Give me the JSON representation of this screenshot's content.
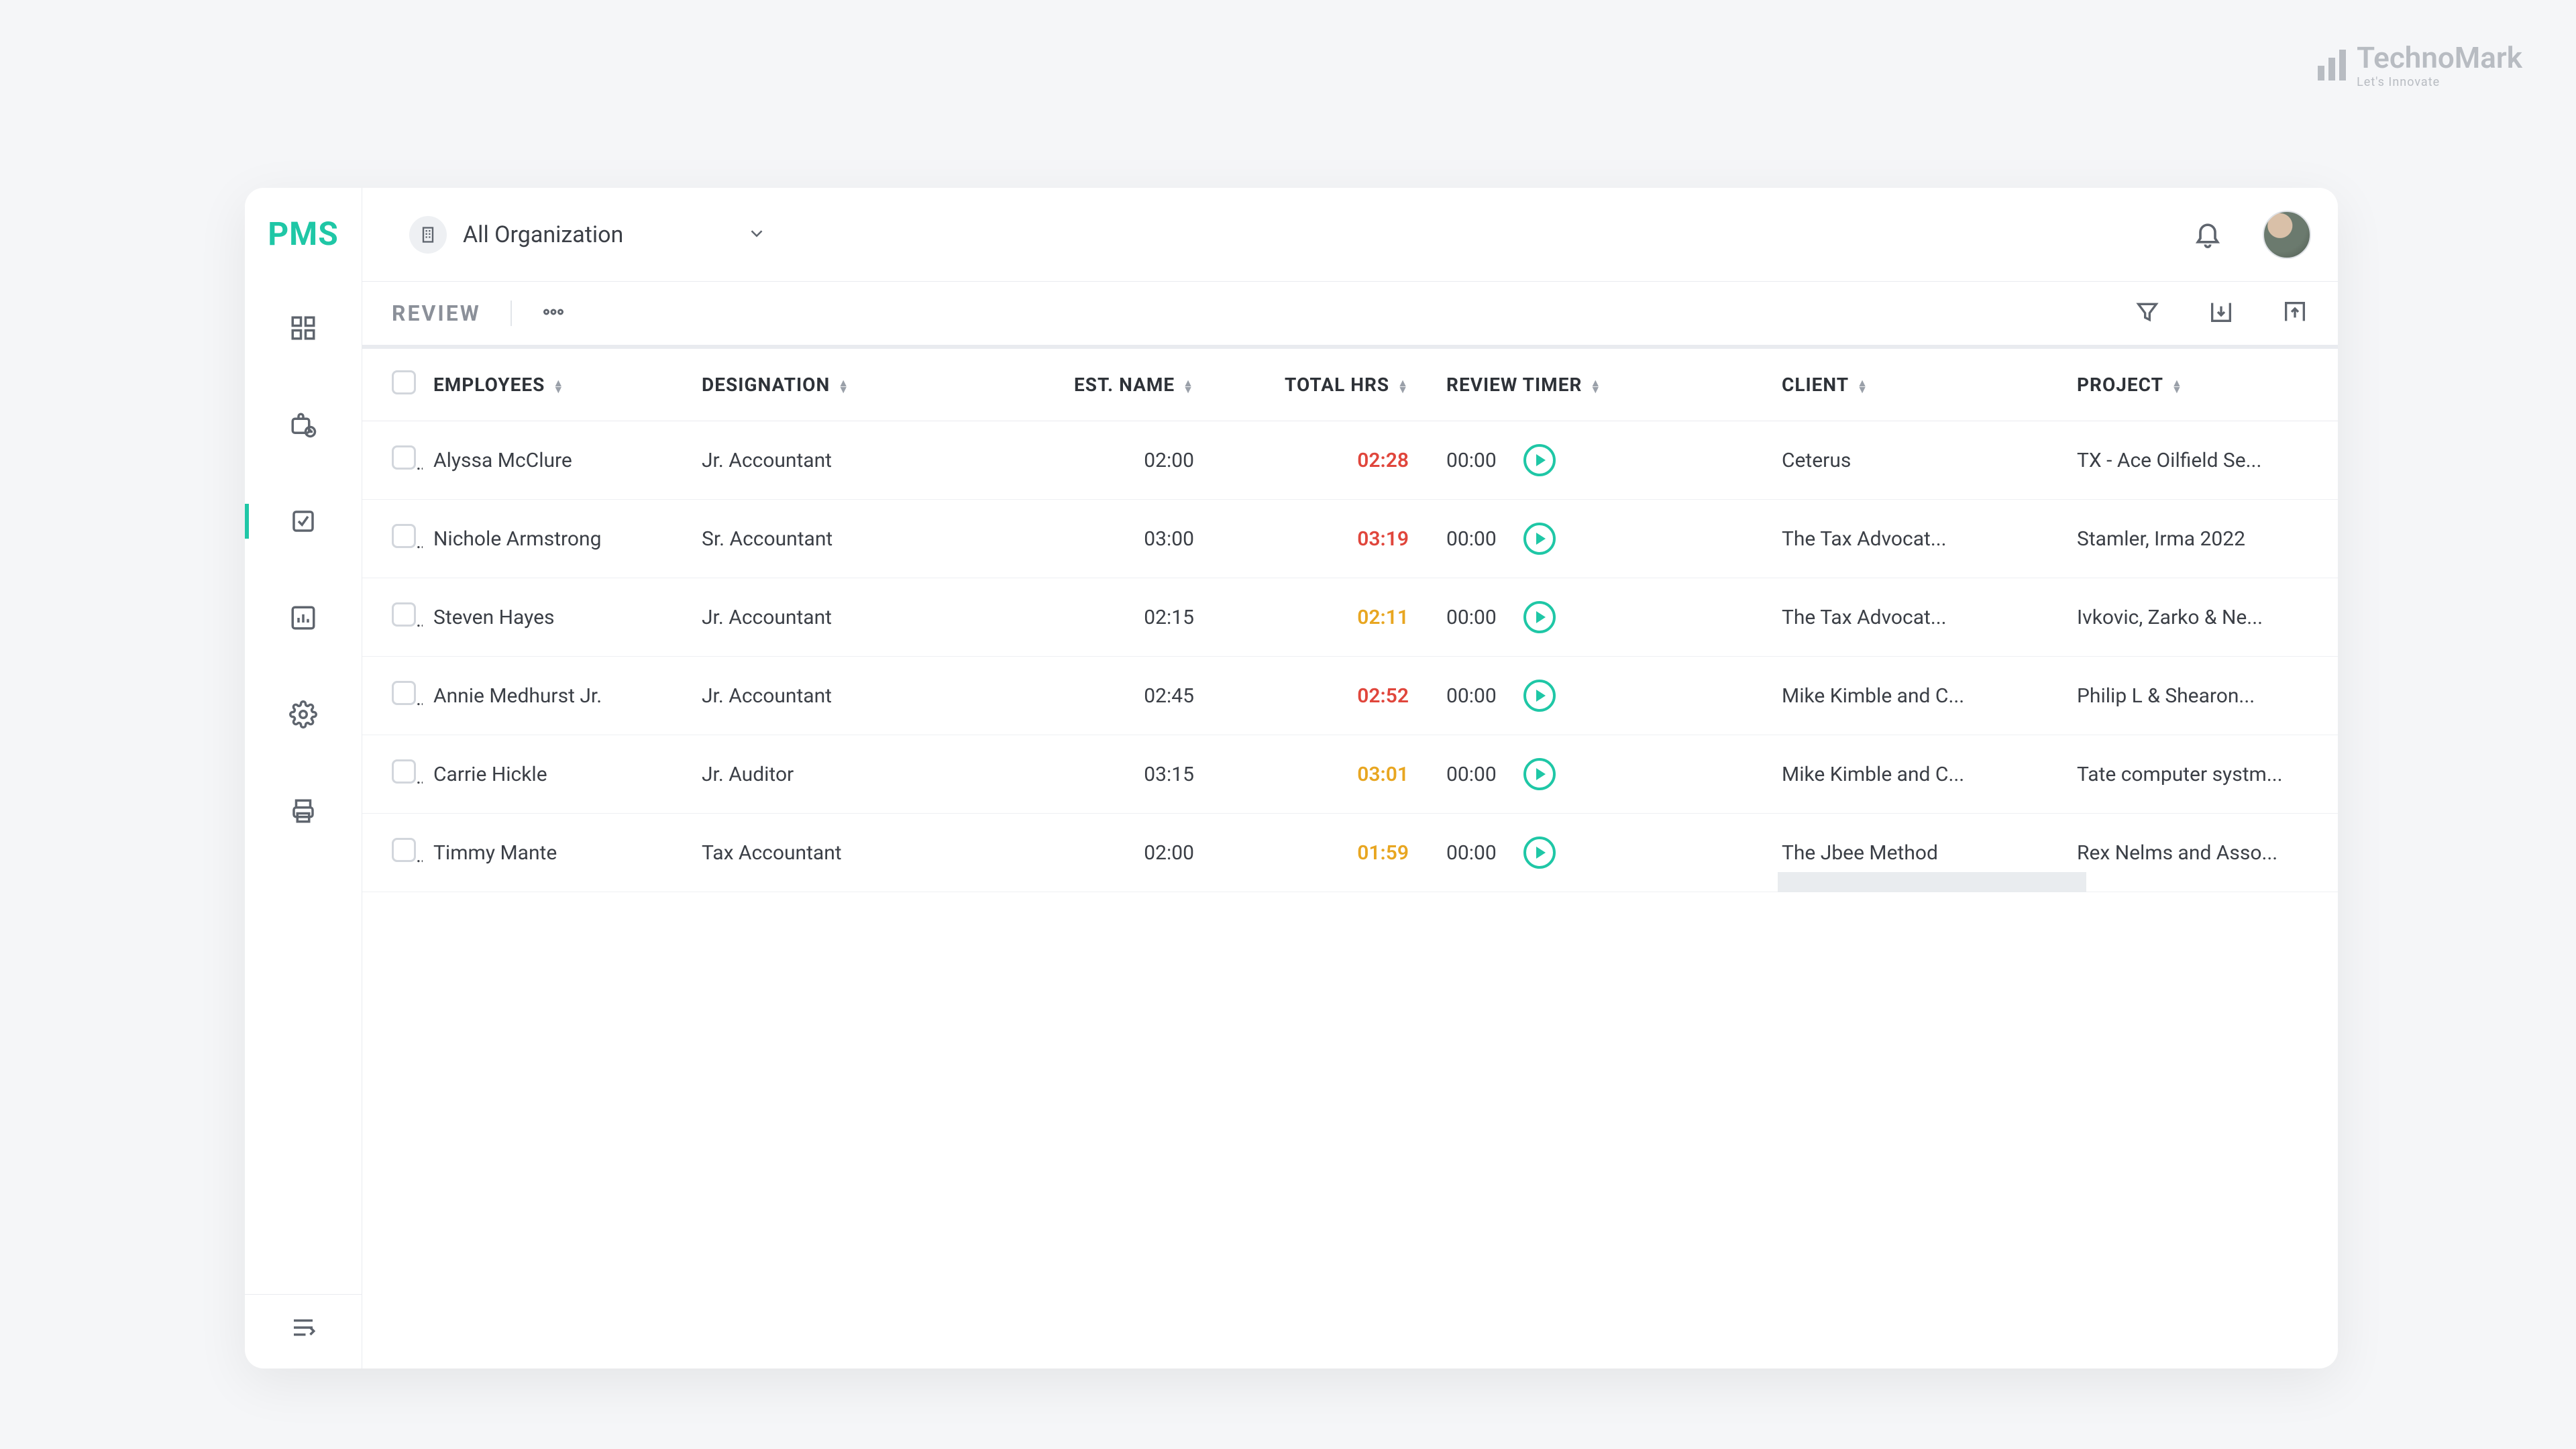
{
  "brand": {
    "name": "TechnoMark",
    "tagline": "Let's Innovate"
  },
  "app": {
    "logo": "PMS"
  },
  "org_selector": {
    "label": "All Organization"
  },
  "toolbar": {
    "title": "REVIEW"
  },
  "columns": {
    "employees": "EMPLOYEES",
    "designation": "DESIGNATION",
    "est_name": "EST. NAME",
    "total_hrs": "TOTAL HRS",
    "review_timer": "REVIEW TIMER",
    "client": "CLIENT",
    "project": "PROJECT"
  },
  "rows": [
    {
      "employee": "Alyssa McClure",
      "designation": "Jr. Accountant",
      "est": "02:00",
      "total": "02:28",
      "total_state": "red",
      "timer": "00:00",
      "client": "Ceterus",
      "project": "TX - Ace Oilfield Se..."
    },
    {
      "employee": "Nichole Armstrong",
      "designation": "Sr. Accountant",
      "est": "03:00",
      "total": "03:19",
      "total_state": "red",
      "timer": "00:00",
      "client": "The Tax Advocat...",
      "project": "Stamler, Irma 2022"
    },
    {
      "employee": "Steven Hayes",
      "designation": "Jr. Accountant",
      "est": "02:15",
      "total": "02:11",
      "total_state": "amber",
      "timer": "00:00",
      "client": "The Tax Advocat...",
      "project": "Ivkovic, Zarko & Ne..."
    },
    {
      "employee": "Annie Medhurst Jr.",
      "designation": "Jr. Accountant",
      "est": "02:45",
      "total": "02:52",
      "total_state": "red",
      "timer": "00:00",
      "client": "Mike Kimble and C...",
      "project": "Philip L & Shearon..."
    },
    {
      "employee": "Carrie Hickle",
      "designation": "Jr. Auditor",
      "est": "03:15",
      "total": "03:01",
      "total_state": "amber",
      "timer": "00:00",
      "client": "Mike Kimble and C...",
      "project": "Tate computer systm..."
    },
    {
      "employee": "Timmy Mante",
      "designation": "Tax Accountant",
      "est": "02:00",
      "total": "01:59",
      "total_state": "amber",
      "timer": "00:00",
      "client": "The Jbee Method",
      "project": "Rex Nelms and Asso..."
    }
  ]
}
